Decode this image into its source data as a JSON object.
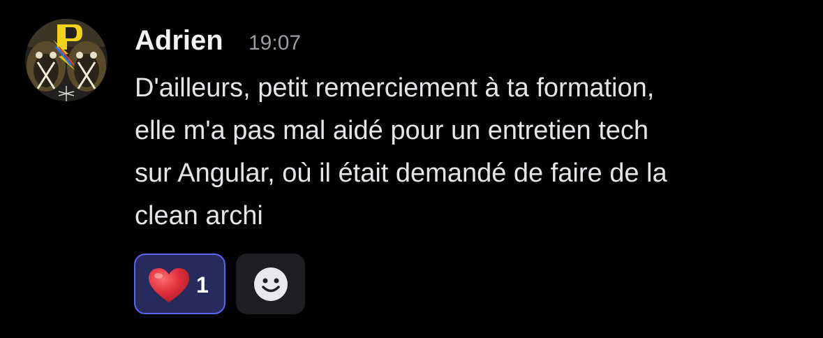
{
  "message": {
    "author": "Adrien",
    "timestamp": "19:07",
    "lines": [
      "D'ailleurs, petit remerciement à ta formation,",
      "elle m'a pas mal aidé pour un entretien tech",
      "sur Angular, où il était demandé de faire de la",
      "clean archi"
    ]
  },
  "reactions": [
    {
      "emoji": "heart-icon",
      "count": "1",
      "selected": true
    }
  ],
  "add_reaction": {
    "icon": "smiley-icon"
  },
  "colors": {
    "background": "#000000",
    "text": "#e3e5e8",
    "muted": "#9a9ca3",
    "reaction_bg": "#262a5c",
    "reaction_border": "#5865f2",
    "heart": "#e0303c"
  }
}
